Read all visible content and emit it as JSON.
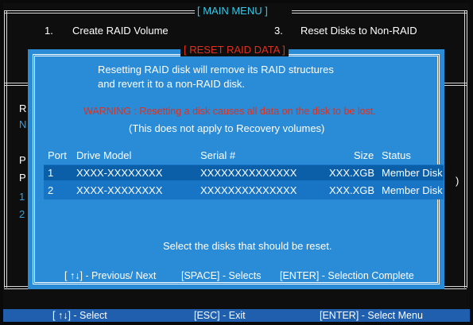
{
  "main_menu": {
    "title": "[ MAIN MENU ]",
    "items": [
      {
        "num": "1.",
        "label": "Create RAID Volume"
      },
      {
        "num": "3.",
        "label": "Reset Disks to Non-RAID"
      }
    ]
  },
  "background_fragments": {
    "left_r": "R",
    "left_n": "N",
    "left_p1": "P",
    "left_p2": "P",
    "left_1": "1",
    "left_2": "2",
    "right_paren": ")"
  },
  "dialog": {
    "title": "[ RESET RAID DATA ]",
    "intro_line1": "Resetting RAID disk will remove its RAID structures",
    "intro_line2": "and revert it to a non-RAID disk.",
    "warning": "WARNING : Resetting a disk causes all data on the disk to be lost.",
    "note": "(This does not apply to Recovery volumes)",
    "columns": {
      "port": "Port",
      "model": "Drive  Model",
      "serial": "Serial #",
      "size": "Size",
      "status": "Status"
    },
    "disks": [
      {
        "port": "1",
        "model": "XXXX-XXXXXXXX",
        "serial": "XXXXXXXXXXXXXX",
        "size": "XXX.XGB",
        "status": "Member Disk",
        "selected": true
      },
      {
        "port": "2",
        "model": "XXXX-XXXXXXXX",
        "serial": "XXXXXXXXXXXXXX",
        "size": "XXX.XGB",
        "status": "Member Disk",
        "selected": false
      }
    ],
    "prompt": "Select the disks that should be reset.",
    "help": {
      "nav": "[ ↑↓] - Previous/ Next",
      "space": "[SPACE] - Selects",
      "enter": "[ENTER] - Selection Complete"
    }
  },
  "footer": {
    "select": "[ ↑↓] - Select",
    "exit": "[ESC] - Exit",
    "enter": "[ENTER] - Select Menu"
  },
  "colors": {
    "dialog_bg": "#2a8bd6",
    "selected_row": "#0b5fa8",
    "warning": "#e0301e",
    "title_cyan": "#33c8e8",
    "footer_bg": "#1f5fae"
  }
}
